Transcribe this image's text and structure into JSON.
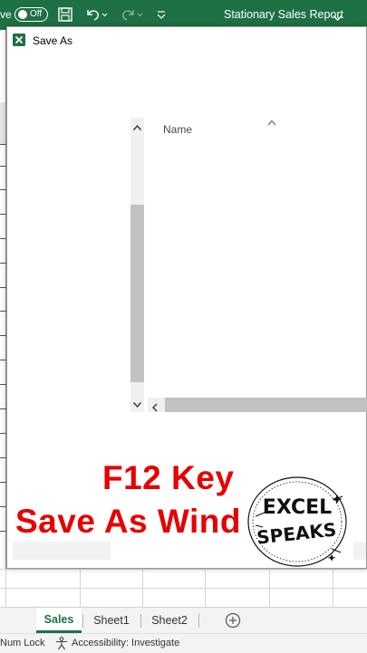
{
  "titlebar": {
    "autosave_partial": "ve",
    "autosave_toggle": "Off",
    "document_title": "Stationary Sales Report"
  },
  "dialog": {
    "title": "Save As",
    "column_header": "Name"
  },
  "sheet_tabs": [
    {
      "label": "Sales",
      "active": true
    },
    {
      "label": "Sheet1",
      "active": false
    },
    {
      "label": "Sheet2",
      "active": false
    }
  ],
  "statusbar": {
    "num_lock": "Num Lock",
    "accessibility": "Accessibility: Investigate"
  },
  "overlay": {
    "line1": "F12 Key",
    "line2": "Save As Wind"
  },
  "logo": {
    "line1": "EXCEL",
    "line2": "SPEAKS"
  },
  "colors": {
    "title_bar": "#1e7145",
    "overlay_text": "#e60000",
    "active_tab": "#1e7145"
  }
}
